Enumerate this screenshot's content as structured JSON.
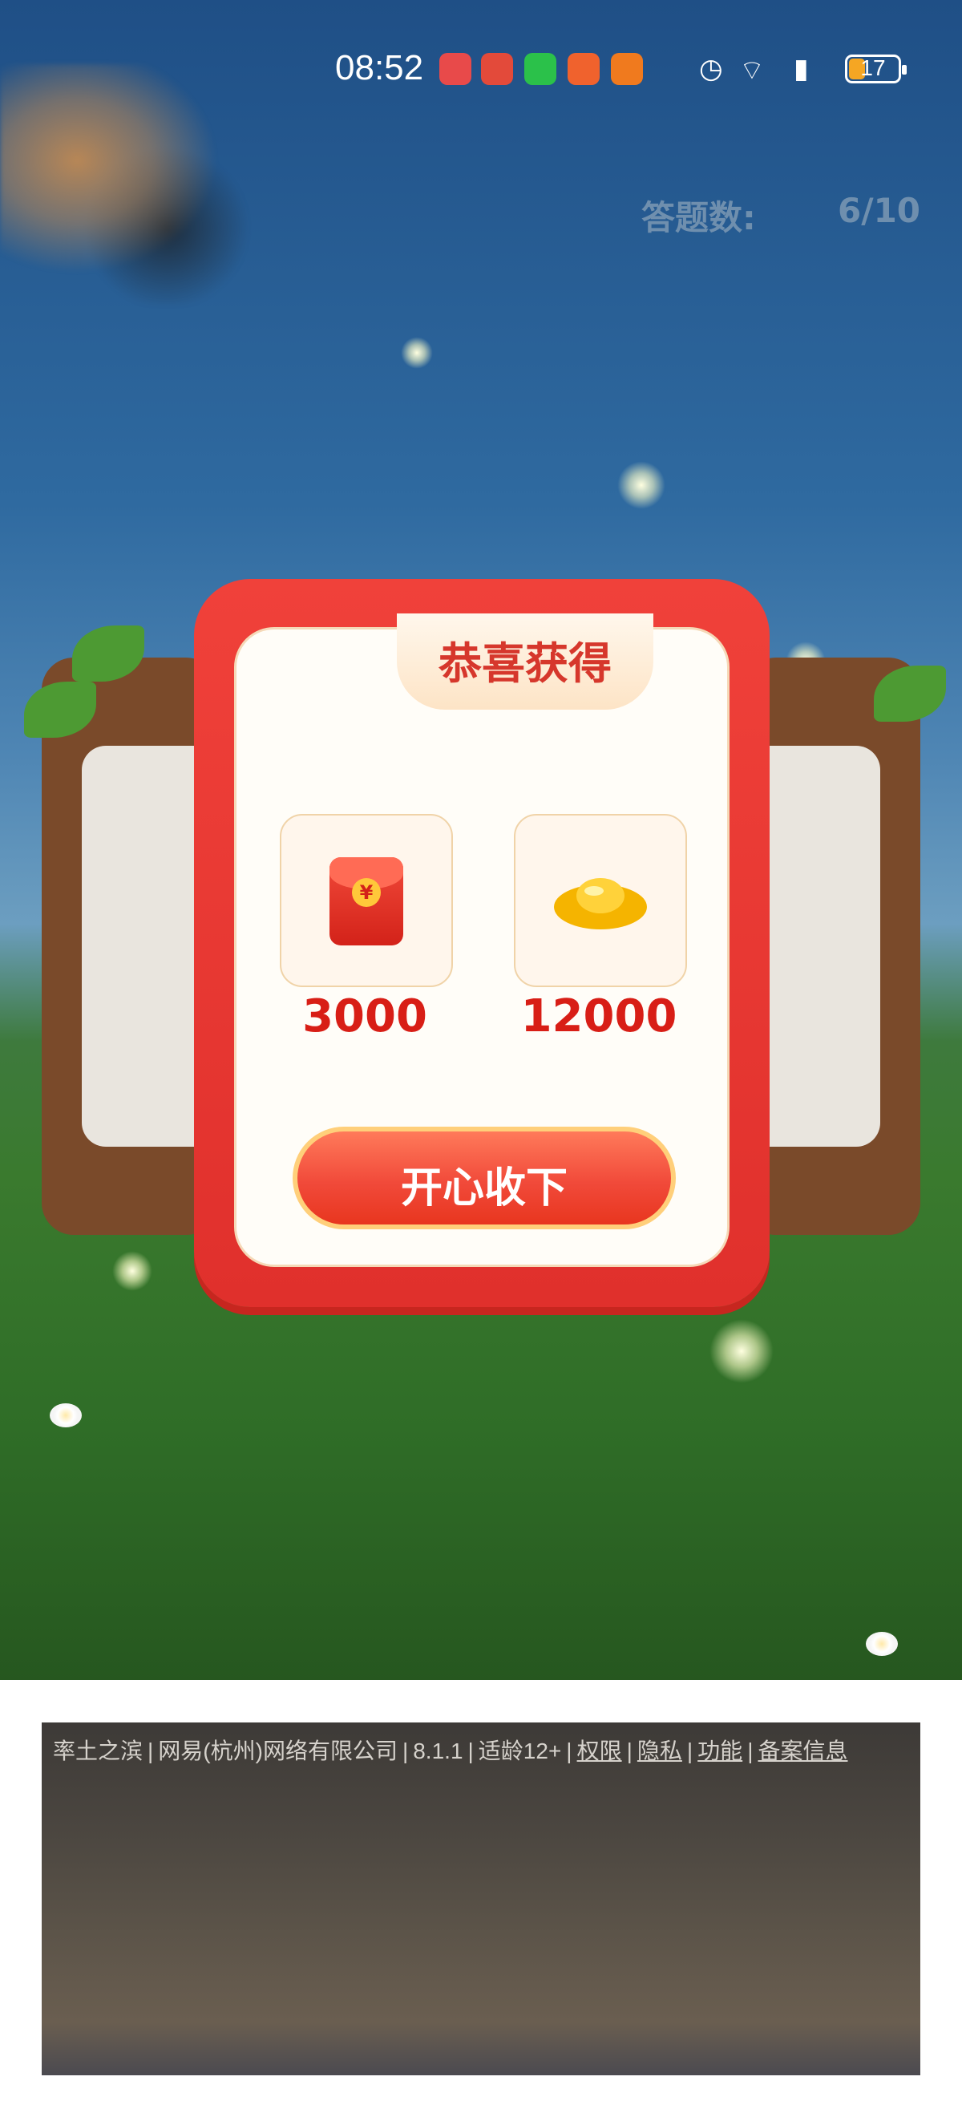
{
  "status_bar": {
    "time": "08:52",
    "battery_level": "17"
  },
  "game": {
    "question_count_label": "答题数:",
    "question_count_value": "6/10"
  },
  "reward_dialog": {
    "title": "恭喜获得",
    "rewards": [
      {
        "icon": "red-packet-icon",
        "value": "3000"
      },
      {
        "icon": "gold-ingot-icon",
        "value": "12000"
      }
    ],
    "claim_button_label": "开心收下"
  },
  "footer": {
    "game_name": "率土之滨",
    "company": "网易(杭州)网络有限公司",
    "version": "8.1.1",
    "age_rating": "适龄12+",
    "links": [
      "权限",
      "隐私",
      "功能",
      "备案信息"
    ]
  }
}
